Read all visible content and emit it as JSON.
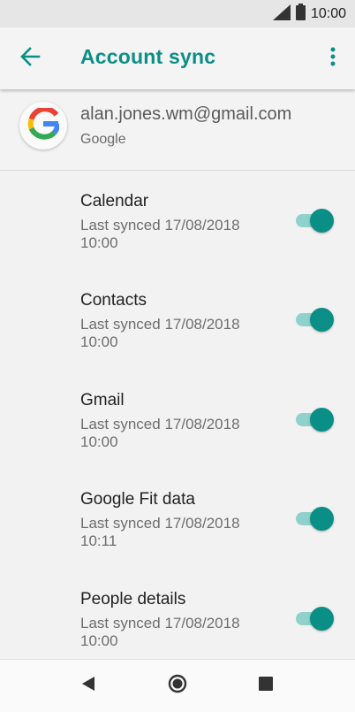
{
  "status_bar": {
    "time": "10:00"
  },
  "toolbar": {
    "title": "Account sync"
  },
  "account": {
    "email": "alan.jones.wm@gmail.com",
    "type": "Google"
  },
  "sync_items": [
    {
      "title": "Calendar",
      "subtitle": "Last synced 17/08/2018 10:00",
      "enabled": true
    },
    {
      "title": "Contacts",
      "subtitle": "Last synced 17/08/2018 10:00",
      "enabled": true
    },
    {
      "title": "Gmail",
      "subtitle": "Last synced 17/08/2018 10:00",
      "enabled": true
    },
    {
      "title": "Google Fit data",
      "subtitle": "Last synced 17/08/2018 10:11",
      "enabled": true
    },
    {
      "title": "People details",
      "subtitle": "Last synced 17/08/2018 10:00",
      "enabled": true
    }
  ],
  "colors": {
    "accent": "#0a8f86",
    "toggle_track": "#8fd1cb"
  },
  "icons": {
    "status": [
      "signal-icon",
      "battery-icon"
    ],
    "toolbar": [
      "back-arrow-icon",
      "more-vert-icon"
    ],
    "account": "google-logo-icon",
    "nav": [
      "nav-back-icon",
      "nav-home-icon",
      "nav-recents-icon"
    ]
  }
}
